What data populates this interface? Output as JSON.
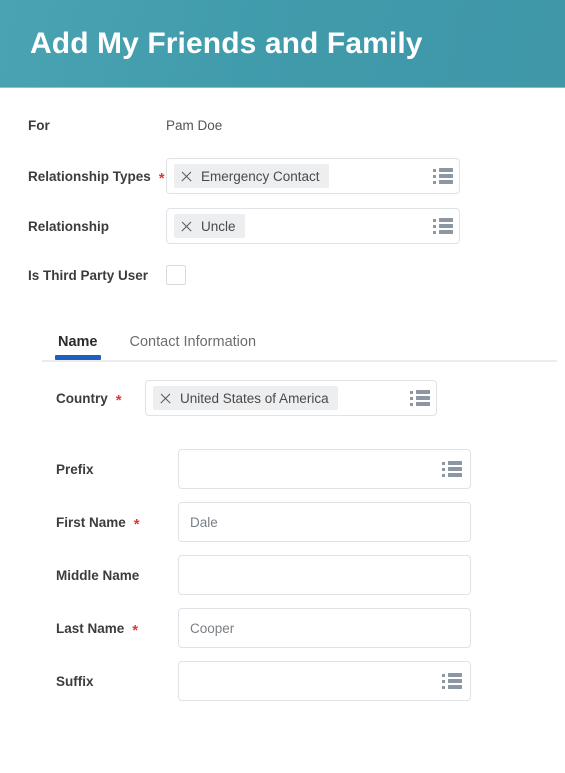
{
  "header": {
    "title": "Add My Friends and Family",
    "bg_start": "#4aa3b2",
    "bg_end": "#3f97a8"
  },
  "colors": {
    "required_asterisk": "#e03a30",
    "active_tab_underline": "#1f5fbf",
    "chip_background": "#eceef0",
    "field_border": "#dfe3e8"
  },
  "top_form": {
    "for": {
      "label": "For",
      "value": "Pam Doe"
    },
    "relationship_types": {
      "label": "Relationship Types",
      "required": "*",
      "chips": [
        "Emergency Contact"
      ],
      "prompt_icon": "list-prompt-icon"
    },
    "relationship": {
      "label": "Relationship",
      "chips": [
        "Uncle"
      ],
      "prompt_icon": "list-prompt-icon"
    },
    "is_third_party_user": {
      "label": "Is Third Party User",
      "checked": false
    }
  },
  "tabs": [
    {
      "label": "Name",
      "active": true
    },
    {
      "label": "Contact Information",
      "active": false
    }
  ],
  "name_section": {
    "country": {
      "label": "Country",
      "required": "*",
      "chips": [
        "United States of America"
      ],
      "prompt_icon": "list-prompt-icon"
    },
    "fields": [
      {
        "label": "Prefix",
        "required": "",
        "value": "",
        "prompt_icon": "list-prompt-icon",
        "has_prompt": true
      },
      {
        "label": "First Name",
        "required": "*",
        "value": "Dale",
        "prompt_icon": "",
        "has_prompt": false
      },
      {
        "label": "Middle Name",
        "required": "",
        "value": "",
        "prompt_icon": "",
        "has_prompt": false
      },
      {
        "label": "Last Name",
        "required": "*",
        "value": "Cooper",
        "prompt_icon": "",
        "has_prompt": false
      },
      {
        "label": "Suffix",
        "required": "",
        "value": "",
        "prompt_icon": "list-prompt-icon",
        "has_prompt": true
      }
    ]
  }
}
